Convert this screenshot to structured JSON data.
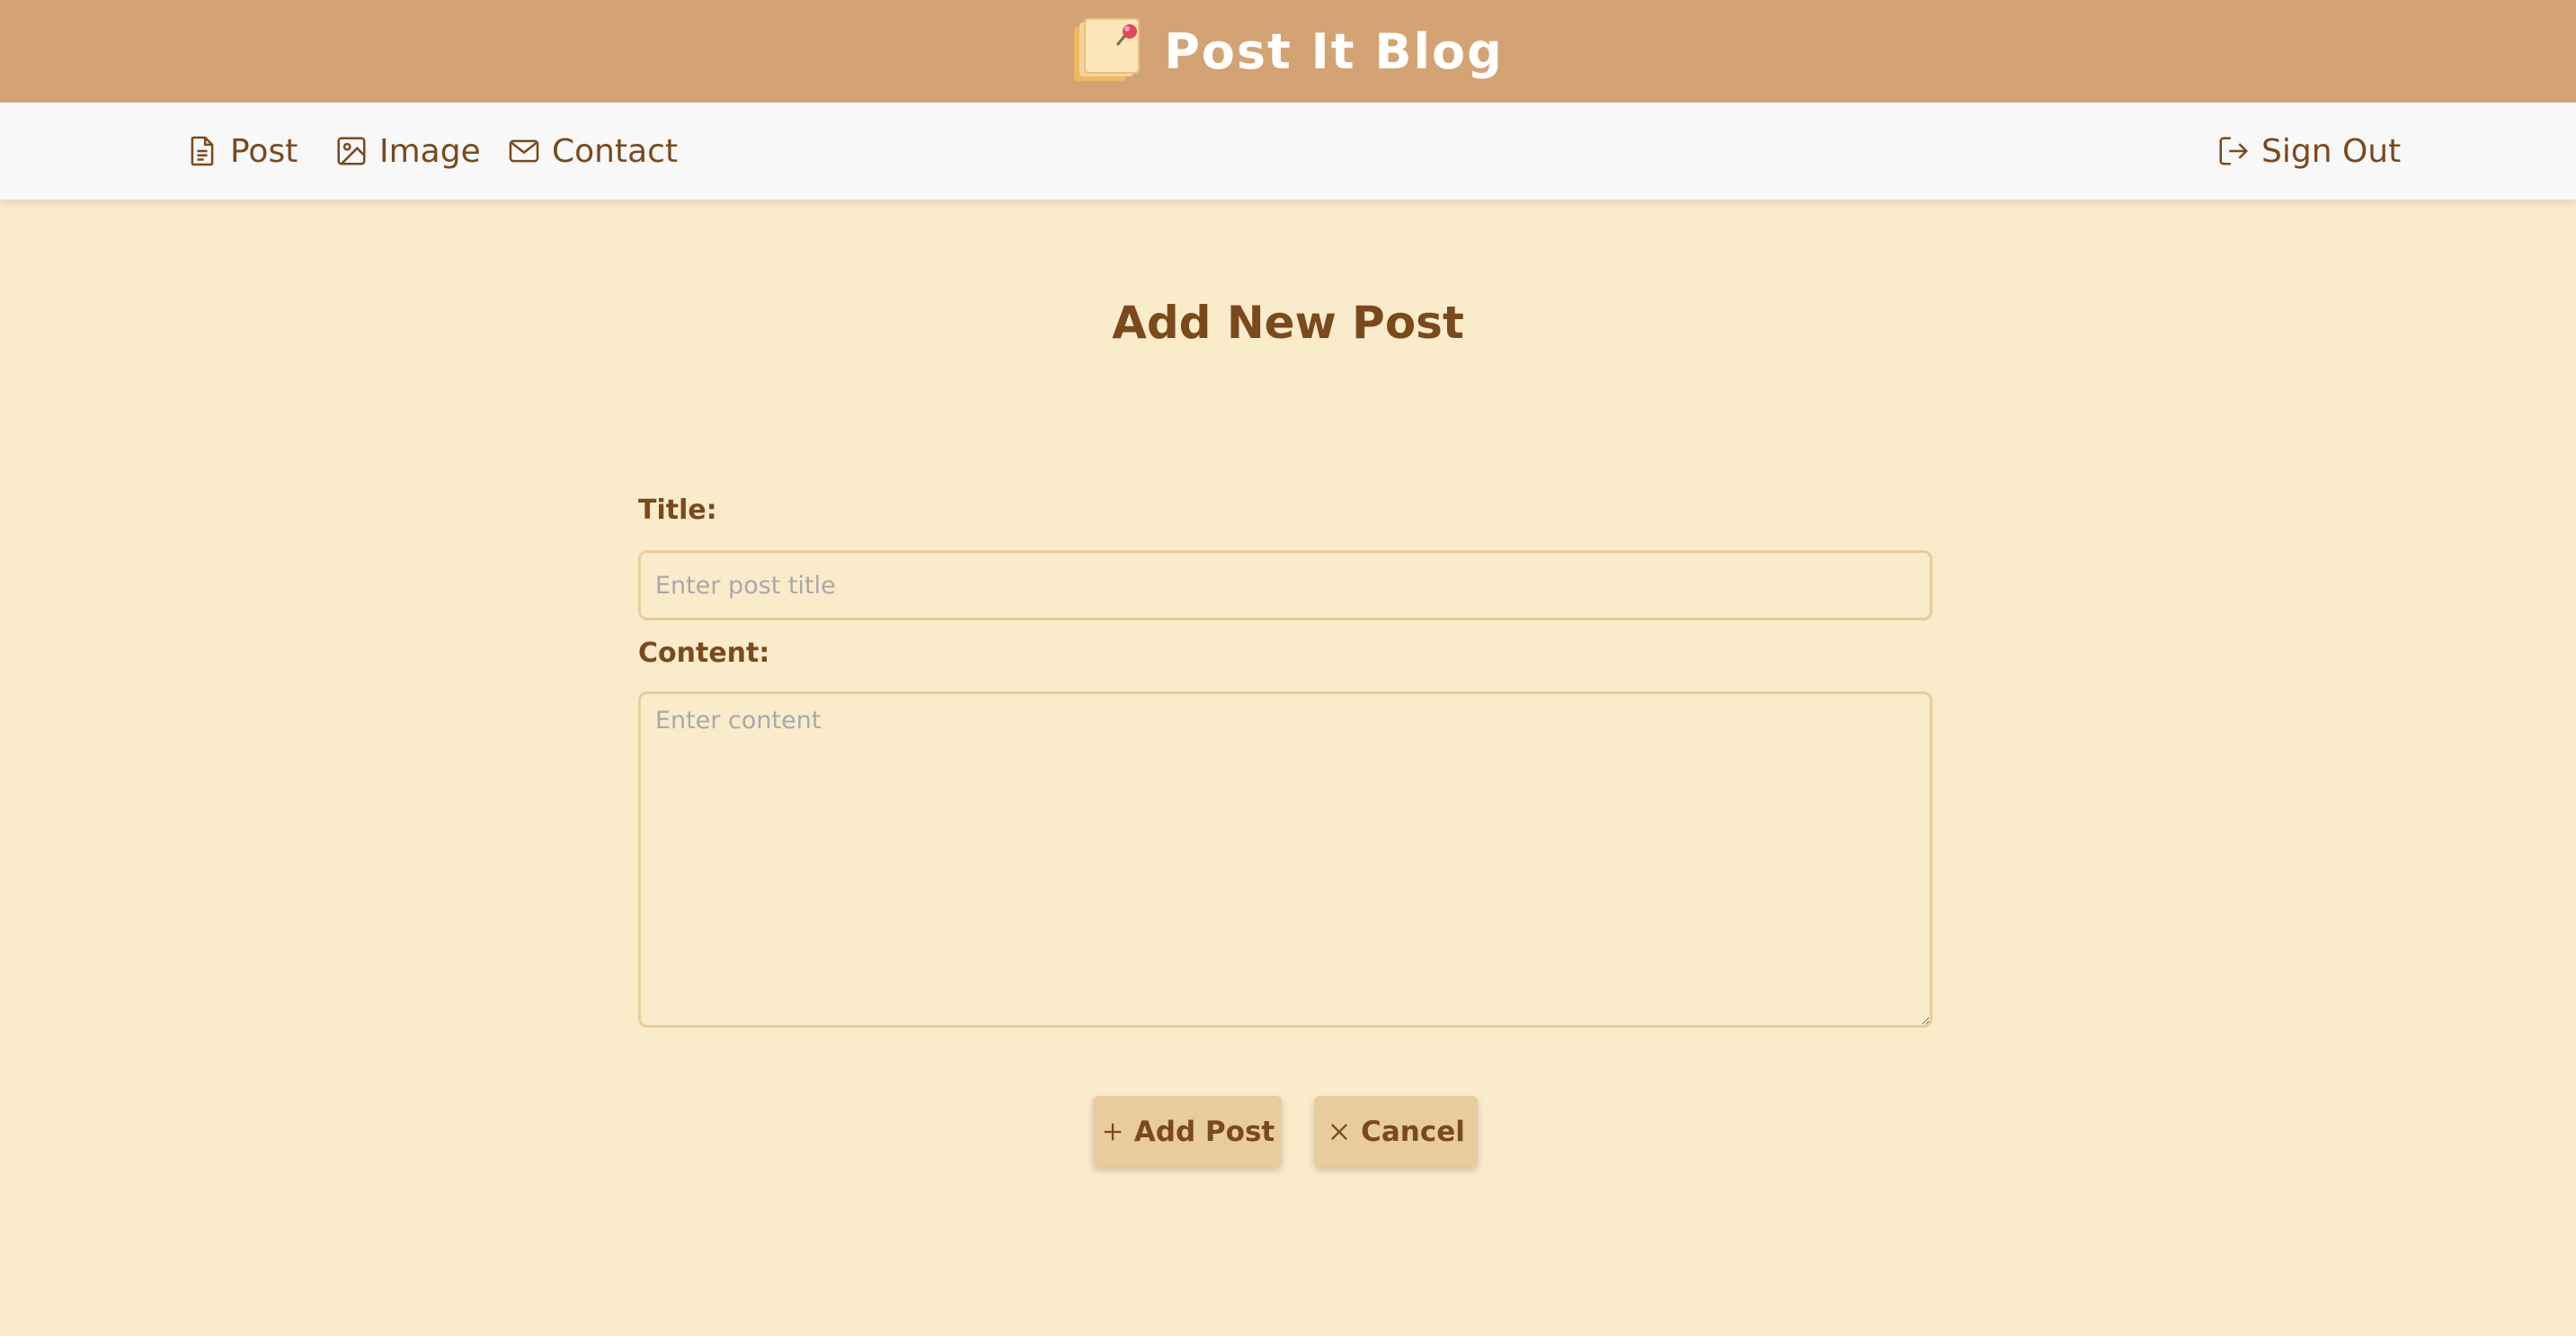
{
  "header": {
    "brand_title": "Post It Blog",
    "logo_icon": "sticky-note-pin-icon",
    "background_color": "#d4a373"
  },
  "nav": {
    "items": [
      {
        "label": "Post",
        "icon": "document-icon"
      },
      {
        "label": "Image",
        "icon": "image-icon"
      },
      {
        "label": "Contact",
        "icon": "mail-icon"
      }
    ],
    "sign_out": {
      "label": "Sign Out",
      "icon": "sign-out-icon"
    }
  },
  "main": {
    "heading": "Add New Post",
    "title_label": "Title:",
    "title_placeholder": "Enter post title",
    "content_label": "Content:",
    "content_placeholder": "Enter content",
    "add_button": {
      "label": "Add Post",
      "icon": "plus-icon"
    },
    "cancel_button": {
      "label": "Cancel",
      "icon": "close-icon"
    }
  },
  "colors": {
    "page_background": "#faebcb",
    "text": "#7a4a1c",
    "button_background": "#e9cc9c",
    "nav_background": "#f8f8f8"
  }
}
